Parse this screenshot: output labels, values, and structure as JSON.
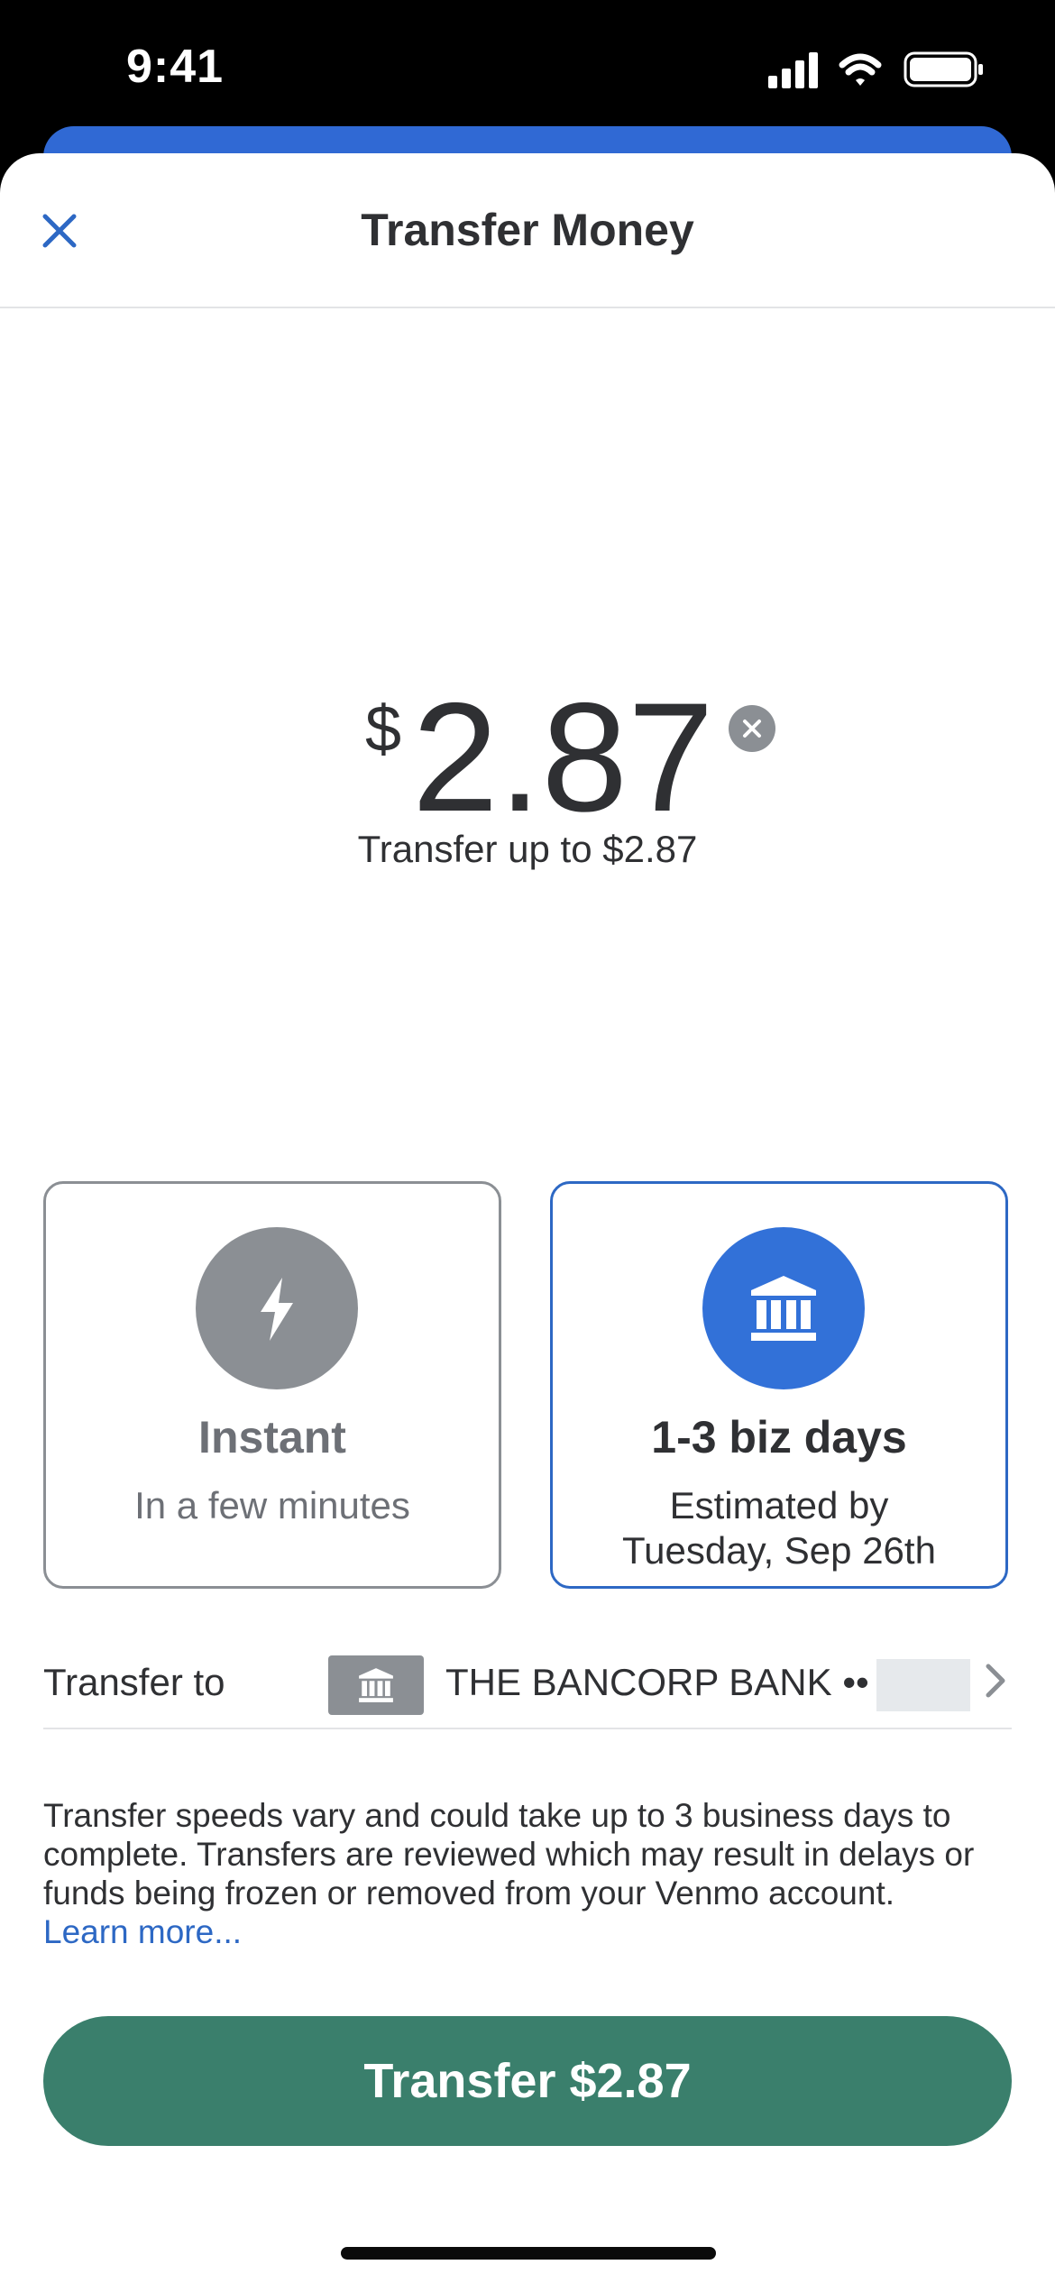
{
  "status_bar": {
    "time": "9:41"
  },
  "header": {
    "title": "Transfer Money"
  },
  "amount": {
    "currency": "$",
    "value": "2.87",
    "limit_text": "Transfer up to $2.87"
  },
  "options": {
    "instant": {
      "title": "Instant",
      "subtitle": "In a few minutes",
      "selected": false
    },
    "standard": {
      "title": "1-3 biz days",
      "subtitle_line1": "Estimated by",
      "subtitle_line2": "Tuesday, Sep 26th",
      "selected": true
    }
  },
  "transfer_to": {
    "label": "Transfer to",
    "bank_name": "THE BANCORP BANK ••"
  },
  "disclaimer": {
    "text": "Transfer speeds vary and could take up to 3 business days to complete. Transfers are reviewed which may result in delays or funds being frozen or removed from your Venmo account.",
    "link": "Learn more..."
  },
  "transfer_button": {
    "label": "Transfer $2.87"
  },
  "colors": {
    "accent_blue": "#2d68c4",
    "button_green": "#3a7f6c",
    "muted_gray": "#8b8f94"
  },
  "icons": [
    "close-icon",
    "clear-icon",
    "lightning-icon",
    "bank-icon",
    "chevron-right-icon",
    "cellular-signal-icon",
    "wifi-icon",
    "battery-icon"
  ]
}
